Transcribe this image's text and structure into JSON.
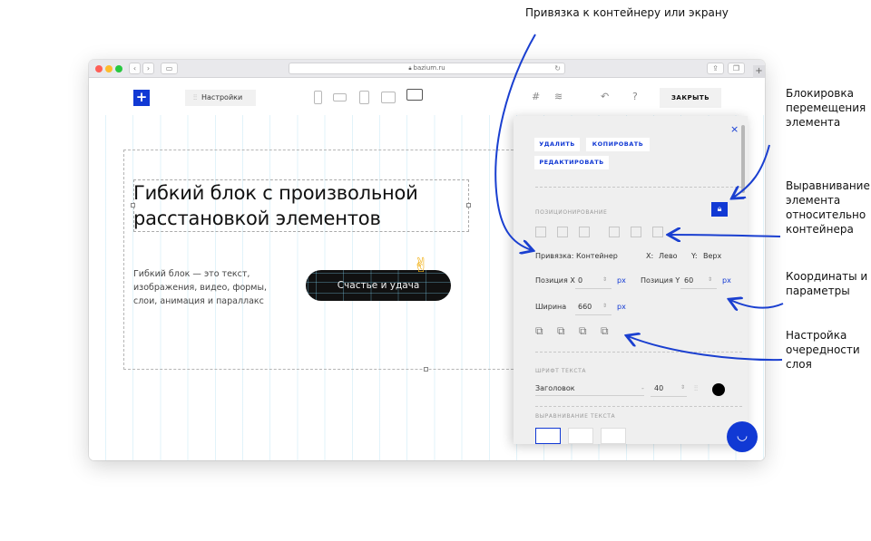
{
  "annotations": {
    "anchor": "Привязка к контейнеру или экрану",
    "lock": "Блокировка перемещения элемента",
    "align": "Выравнивание элемента относительно контейнера",
    "coords": "Координаты и параметры",
    "layers": "Настройка очередности слоя"
  },
  "browser": {
    "url": "bazium.ru"
  },
  "toolbar": {
    "add_label": "+",
    "settings_label": "Настройки",
    "close_label": "ЗАКРЫТЬ",
    "undo_symbol": "↶",
    "help_symbol": "?"
  },
  "canvas": {
    "heading": "Гибкий блок с произвольной расстановкой элементов",
    "body_text": "Гибкий блок — это текст, изображения, видео, формы, слои, анимация и параллакс",
    "cta_label": "Счастье и удача",
    "emoji": "✌"
  },
  "panel": {
    "close_symbol": "×",
    "delete_label": "УДАЛИТЬ",
    "copy_label": "КОПИРОВАТЬ",
    "edit_label": "РЕДАКТИРОВАТЬ",
    "positioning_label": "ПОЗИЦИОНИРОВАНИЕ",
    "anchor_label": "Привязка:",
    "anchor_value": "Контейнер",
    "x_label": "X:",
    "x_value": "Лево",
    "y_label": "Y:",
    "y_value": "Верх",
    "pos_x_label": "Позиция X",
    "pos_x_value": "0",
    "pos_y_label": "Позиция Y",
    "pos_y_value": "60",
    "width_label": "Ширина",
    "width_value": "660",
    "unit": "px",
    "font_section_label": "ШРИФТ ТЕКСТА",
    "font_value": "Заголовок",
    "font_dash": "-",
    "font_size_value": "40",
    "text_align_label": "ВЫРАВНИВАНИЕ ТЕКСТА"
  },
  "colors": {
    "accent": "#1139d4",
    "annotation_arrow": "#1a3fd0",
    "cta_background": "#111111"
  }
}
